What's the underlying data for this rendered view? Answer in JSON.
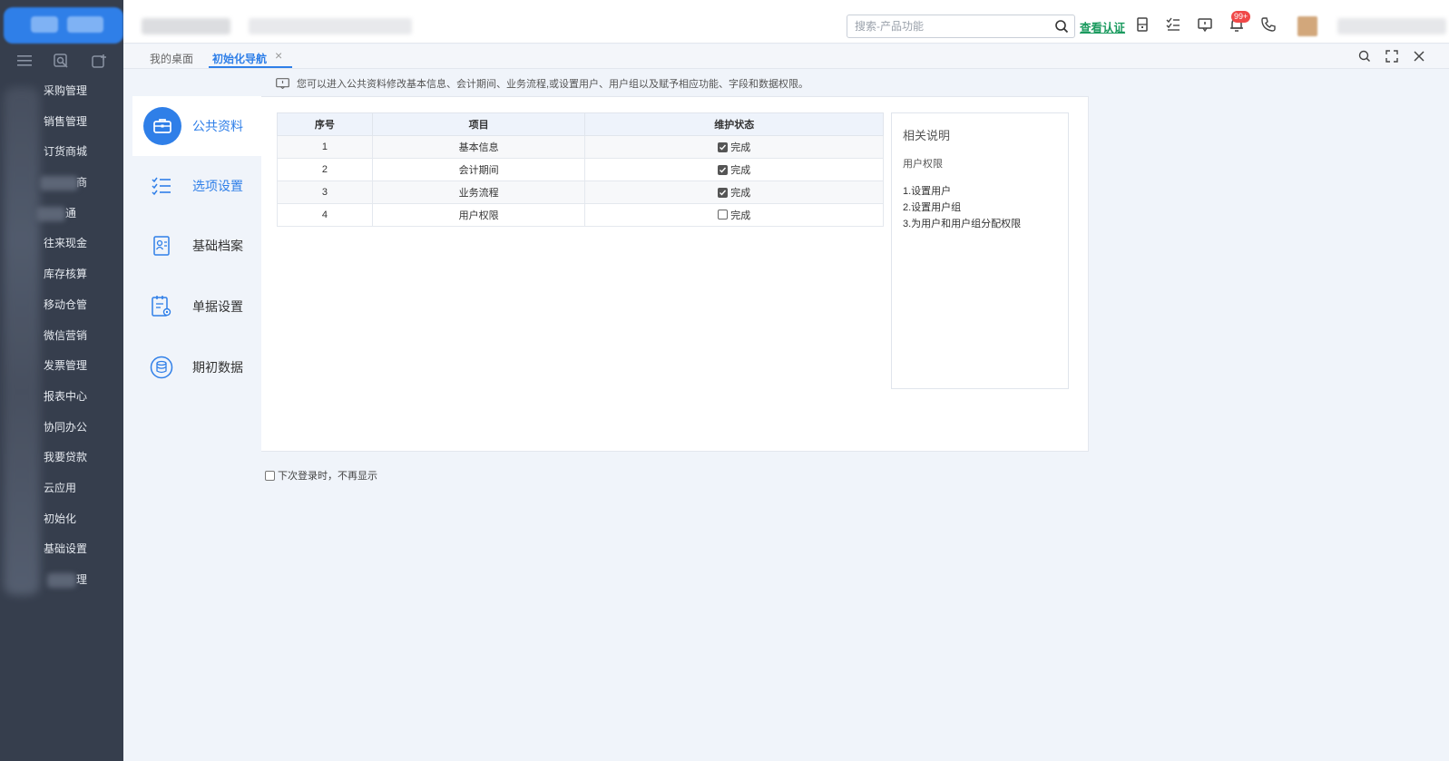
{
  "sidebar": {
    "items": [
      {
        "label": "采购管理"
      },
      {
        "label": "销售管理"
      },
      {
        "label": "订货商城"
      },
      {
        "label": "商"
      },
      {
        "label": "通"
      },
      {
        "label": "往来现金"
      },
      {
        "label": "库存核算"
      },
      {
        "label": "移动仓管"
      },
      {
        "label": "微信营销"
      },
      {
        "label": "发票管理"
      },
      {
        "label": "报表中心"
      },
      {
        "label": "协同办公"
      },
      {
        "label": "我要贷款"
      },
      {
        "label": "云应用"
      },
      {
        "label": "初始化"
      },
      {
        "label": "基础设置"
      },
      {
        "label": "理"
      }
    ]
  },
  "topbar": {
    "search_placeholder": "搜索-产品功能",
    "verify_label": "查看认证",
    "notification_badge": "99+"
  },
  "tabs": {
    "desktop": "我的桌面",
    "init_nav": "初始化导航"
  },
  "notice": "您可以进入公共资料修改基本信息、会计期间、业务流程,或设置用户、用户组以及赋予相应功能、字段和数据权限。",
  "nav": {
    "public_data": "公共资料",
    "options": "选项设置",
    "basic_archive": "基础档案",
    "doc_settings": "单据设置",
    "opening_data": "期初数据"
  },
  "table": {
    "headers": {
      "seq": "序号",
      "item": "项目",
      "status": "维护状态"
    },
    "rows": [
      {
        "seq": "1",
        "item": "基本信息",
        "status": "完成",
        "checked": true
      },
      {
        "seq": "2",
        "item": "会计期间",
        "status": "完成",
        "checked": true
      },
      {
        "seq": "3",
        "item": "业务流程",
        "status": "完成",
        "checked": true
      },
      {
        "seq": "4",
        "item": "用户权限",
        "status": "完成",
        "checked": false
      }
    ]
  },
  "notes": {
    "title": "相关说明",
    "subtitle": "用户权限",
    "lines": [
      "1.设置用户",
      "2.设置用户组",
      "3.为用户和用户组分配权限"
    ]
  },
  "footer": {
    "dont_show": "下次登录时，不再显示"
  }
}
